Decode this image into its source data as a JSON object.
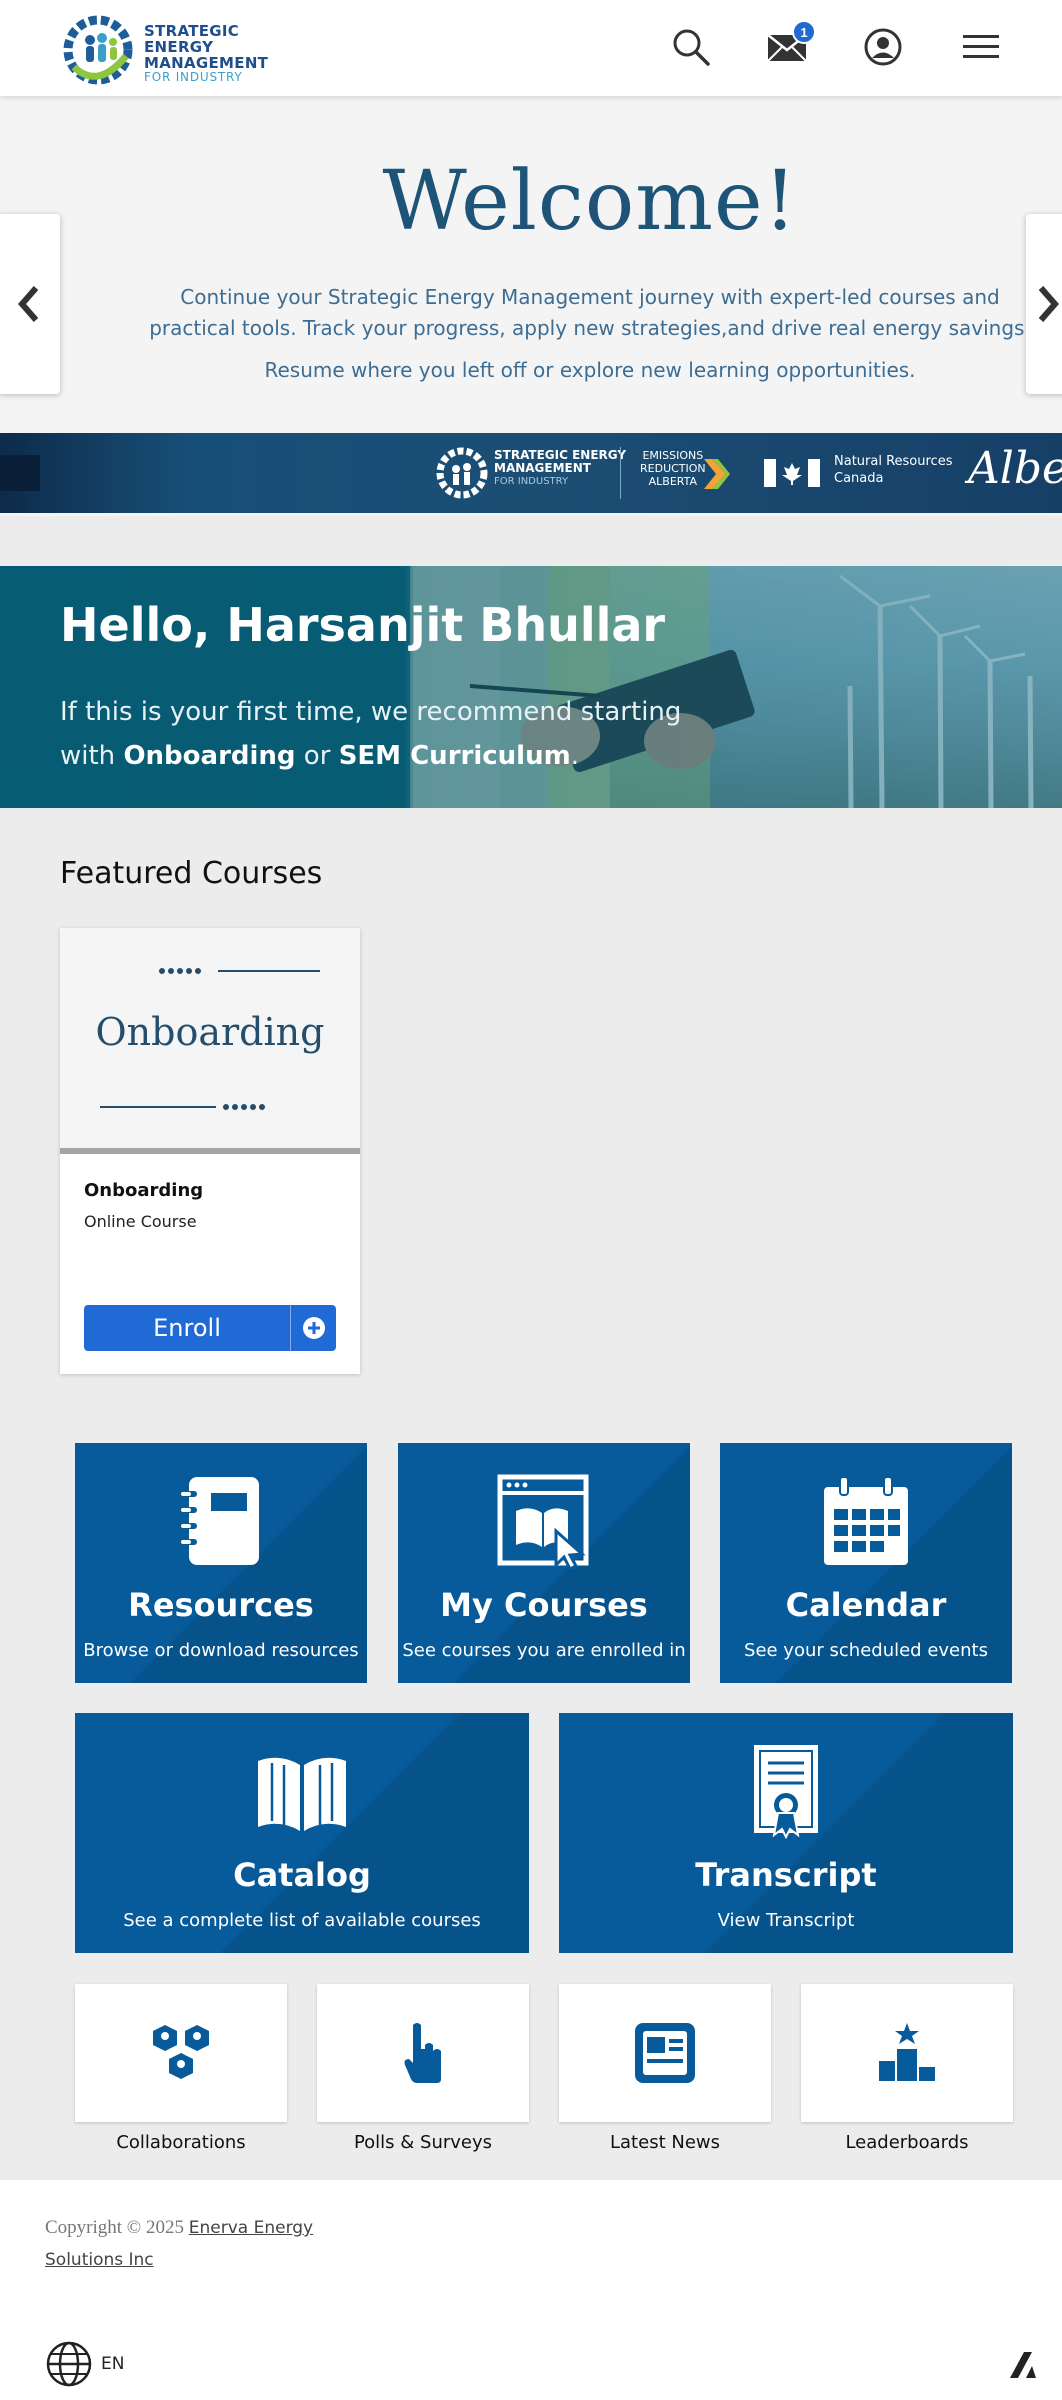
{
  "header": {
    "logo": {
      "line1": "STRATEGIC ENERGY",
      "line2": "MANAGEMENT",
      "line3": "FOR INDUSTRY"
    },
    "icons": [
      "search-icon",
      "mail-icon",
      "user-account-icon",
      "menu-icon"
    ],
    "mail_badge": "1"
  },
  "carousel": {
    "heading": "Welcome!",
    "line1": "Continue your Strategic Energy Management journey with expert-led courses and",
    "line2": "practical tools. Track your progress, apply new strategies,and drive real energy savings.",
    "line3": "Resume where you left off or explore new learning opportunities.",
    "strip": {
      "sem_line1": "STRATEGIC ENERGY",
      "sem_line2": "MANAGEMENT",
      "sem_line3": "FOR INDUSTRY",
      "era_line1": "EMISSIONS",
      "era_line2": "REDUCTION",
      "era_line3": "ALBERTA",
      "nrc_line1": "Natural Resources",
      "nrc_line2": "Canada",
      "alberta": "Albe"
    }
  },
  "hero": {
    "greeting": "Hello, Harsanjit Bhullar",
    "text_before": "If this is your first time, we recommend starting with ",
    "link1": "Onboarding",
    "text_mid": " or ",
    "link2": "SEM Curriculum",
    "text_after": "."
  },
  "featured": {
    "title": "Featured Courses",
    "course": {
      "thumb_title": "Onboarding",
      "name": "Onboarding",
      "type": "Online Course",
      "enroll_label": "Enroll"
    }
  },
  "tiles": [
    {
      "title": "Resources",
      "subtitle": "Browse or download resources",
      "icon": "notebook-icon"
    },
    {
      "title": "My Courses",
      "subtitle": "See courses you are enrolled in",
      "icon": "courses-icon"
    },
    {
      "title": "Calendar",
      "subtitle": "See your scheduled events",
      "icon": "calendar-icon"
    },
    {
      "title": "Catalog",
      "subtitle": "See a complete list of available courses",
      "icon": "open-book-icon"
    },
    {
      "title": "Transcript",
      "subtitle": "View Transcript",
      "icon": "certificate-icon"
    }
  ],
  "mini_tiles": [
    {
      "label": "Collaborations",
      "icon": "hexagon-group-icon"
    },
    {
      "label": "Polls & Surveys",
      "icon": "hand-pointer-icon"
    },
    {
      "label": "Latest News",
      "icon": "newspaper-icon"
    },
    {
      "label": "Leaderboards",
      "icon": "podium-icon"
    }
  ],
  "footer": {
    "copyright": "Copyright © 2025 ",
    "company": "Enerva Energy Solutions Inc",
    "language": "EN"
  },
  "colors": {
    "brand_blue": "#075b9b",
    "button_blue": "#1f6ad4",
    "hero_teal": "#065c74",
    "heading_navy": "#1e5477"
  }
}
